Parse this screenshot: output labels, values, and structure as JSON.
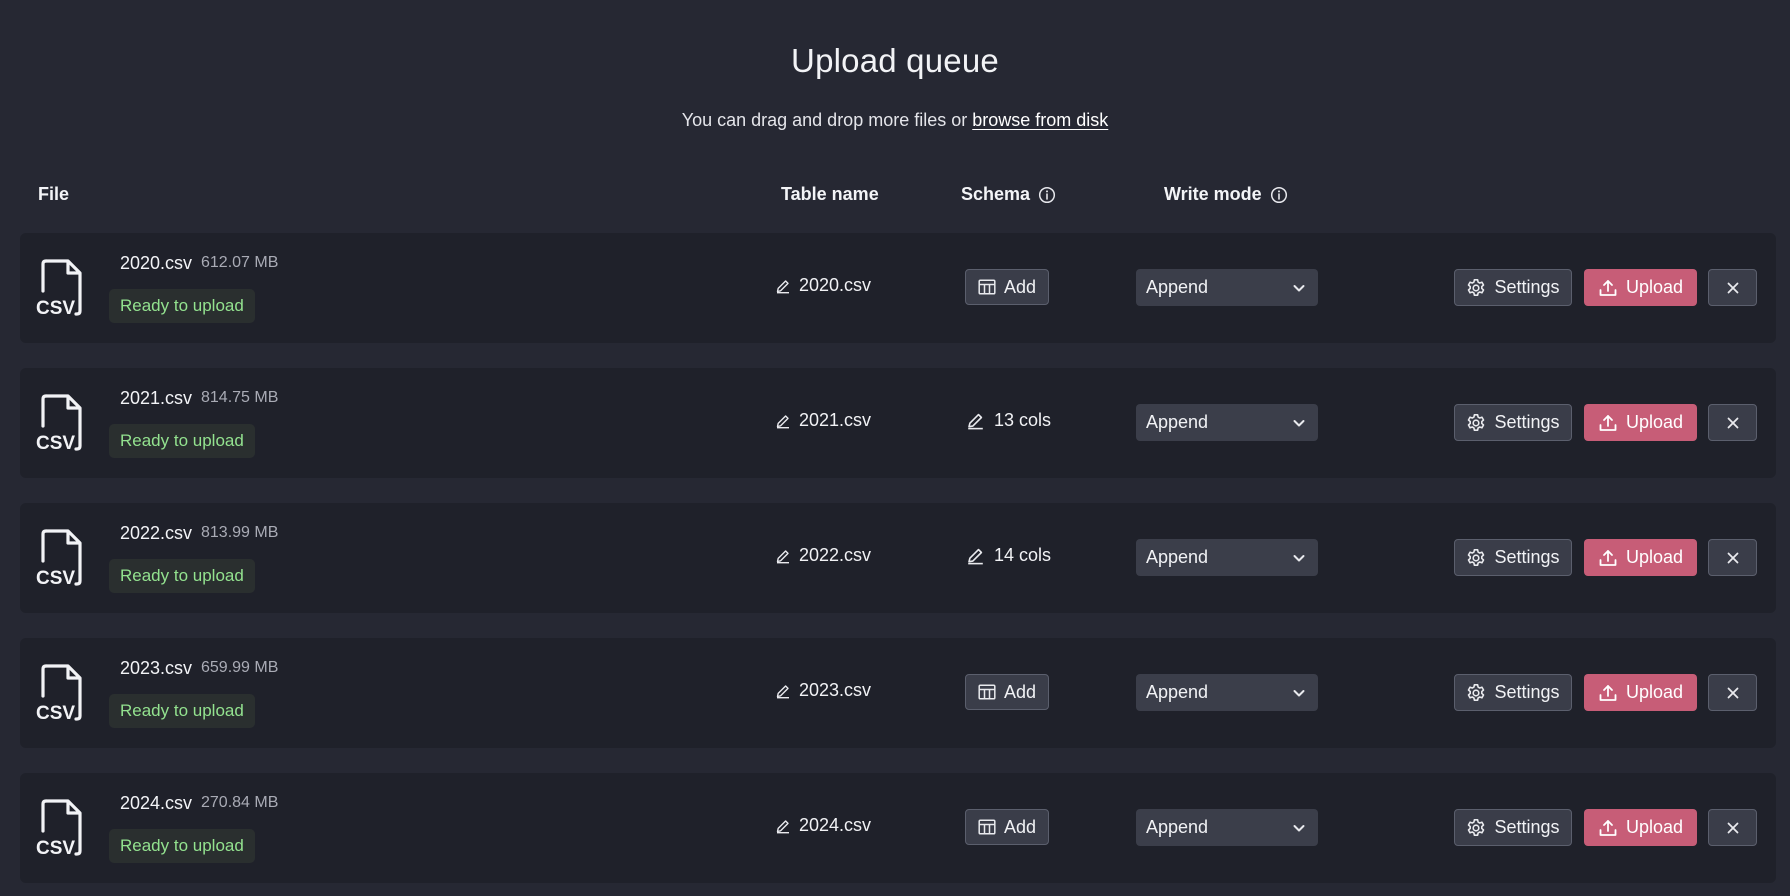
{
  "page": {
    "title": "Upload queue",
    "subtitle_prefix": "You can drag and drop more files or ",
    "subtitle_link": "browse from disk"
  },
  "columns": {
    "file": "File",
    "table_name": "Table name",
    "schema": "Schema",
    "write_mode": "Write mode"
  },
  "icons": {
    "file_type": "csv-file-icon",
    "info": "info-icon",
    "edit": "pencil-icon",
    "schema_add": "table-icon",
    "dropdown": "chevron-down-icon",
    "settings": "gear-icon",
    "upload": "upload-icon",
    "remove": "close-icon"
  },
  "colors": {
    "background": "#262833",
    "row_background": "#1f212a",
    "status_text": "#93e28f",
    "upload_button": "#c75d77"
  },
  "labels": {
    "csv_icon_text": "CSV",
    "settings_button": "Settings",
    "upload_button": "Upload",
    "remove_button": "✕"
  },
  "files": [
    {
      "name": "2020.csv",
      "size": "612.07 MB",
      "status": "Ready to upload",
      "table_name": "2020.csv",
      "schema_type": "add",
      "schema_label": "Add",
      "write_mode": "Append"
    },
    {
      "name": "2021.csv",
      "size": "814.75 MB",
      "status": "Ready to upload",
      "table_name": "2021.csv",
      "schema_type": "cols",
      "schema_label": "13 cols",
      "write_mode": "Append"
    },
    {
      "name": "2022.csv",
      "size": "813.99 MB",
      "status": "Ready to upload",
      "table_name": "2022.csv",
      "schema_type": "cols",
      "schema_label": "14 cols",
      "write_mode": "Append"
    },
    {
      "name": "2023.csv",
      "size": "659.99 MB",
      "status": "Ready to upload",
      "table_name": "2023.csv",
      "schema_type": "add",
      "schema_label": "Add",
      "write_mode": "Append"
    },
    {
      "name": "2024.csv",
      "size": "270.84 MB",
      "status": "Ready to upload",
      "table_name": "2024.csv",
      "schema_type": "add",
      "schema_label": "Add",
      "write_mode": "Append"
    }
  ]
}
